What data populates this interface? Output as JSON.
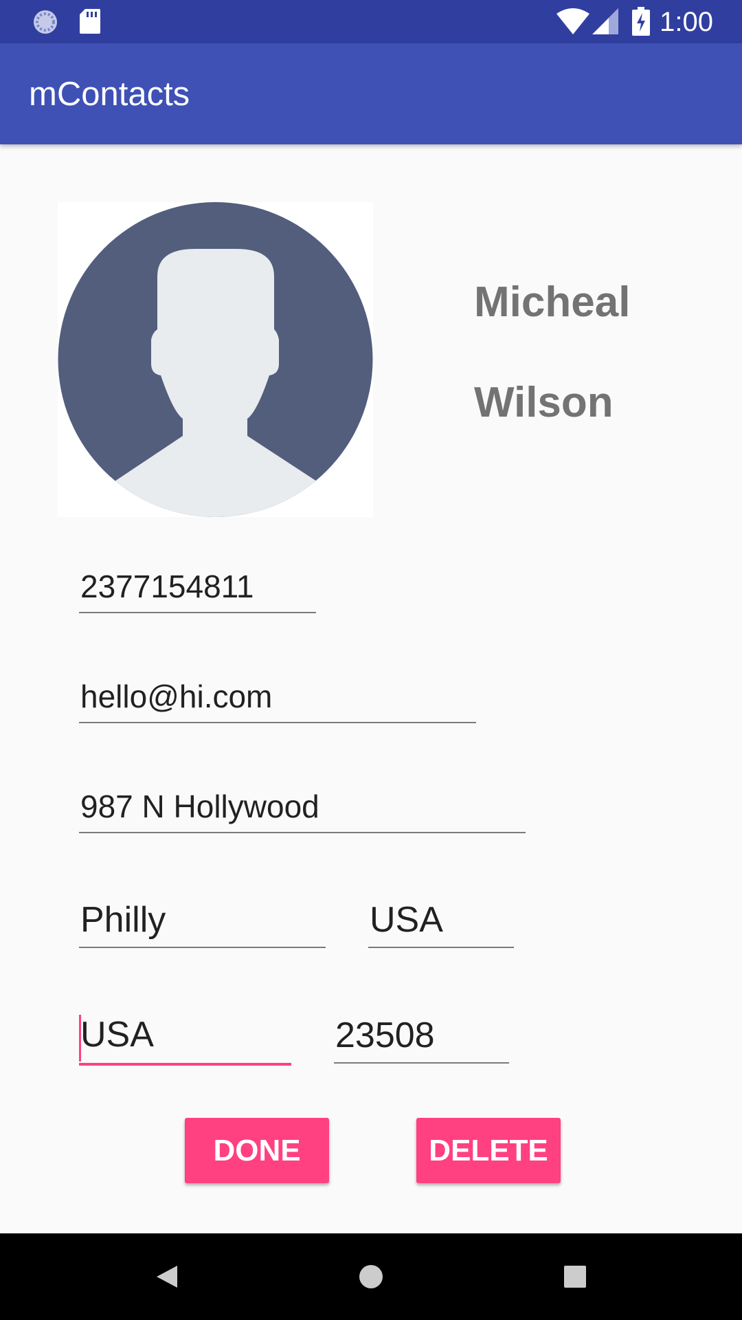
{
  "status_bar": {
    "time": "1:00",
    "icons": [
      "sync-icon",
      "sd-card-icon",
      "wifi-icon",
      "signal-icon",
      "battery-charging-icon"
    ]
  },
  "app_bar": {
    "title": "mContacts"
  },
  "contact": {
    "first_name": "Micheal",
    "last_name": "Wilson",
    "avatar_icon": "person-silhouette-icon"
  },
  "fields": {
    "phone": "2377154811",
    "email": "hello@hi.com",
    "street": "987 N Hollywood",
    "city": "Philly",
    "state": "USA",
    "country": "USA",
    "zip": "23508"
  },
  "buttons": {
    "done": "DONE",
    "delete": "DELETE"
  },
  "colors": {
    "status_bar": "#303f9f",
    "app_bar": "#3f51b5",
    "accent": "#ff4081",
    "name_text": "#737373"
  }
}
